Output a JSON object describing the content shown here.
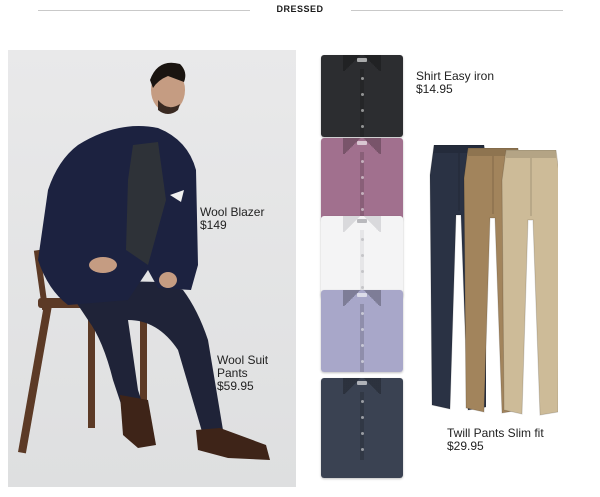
{
  "header": {
    "title": "DRESSED"
  },
  "model": {
    "blazer": {
      "name": "Wool Blazer",
      "price": "$149"
    },
    "pants": {
      "name_line1": "Wool Suit",
      "name_line2": "Pants",
      "price": "$59.95"
    }
  },
  "shirts": {
    "label": {
      "name": "Shirt Easy iron",
      "price": "$14.95"
    },
    "items": [
      {
        "color": "black",
        "hex": "#2c2d30"
      },
      {
        "color": "purple",
        "hex": "#a1708e"
      },
      {
        "color": "white",
        "hex": "#f4f4f5"
      },
      {
        "color": "lilac",
        "hex": "#a8a7c9"
      },
      {
        "color": "navy",
        "hex": "#3a4252"
      }
    ]
  },
  "twill_pants": {
    "label": {
      "name": "Twill Pants Slim fit",
      "price": "$29.95"
    },
    "items": [
      {
        "color": "navy",
        "hex": "#2a3244"
      },
      {
        "color": "tan",
        "hex": "#a2845c"
      },
      {
        "color": "khaki",
        "hex": "#cdbb98"
      }
    ]
  }
}
